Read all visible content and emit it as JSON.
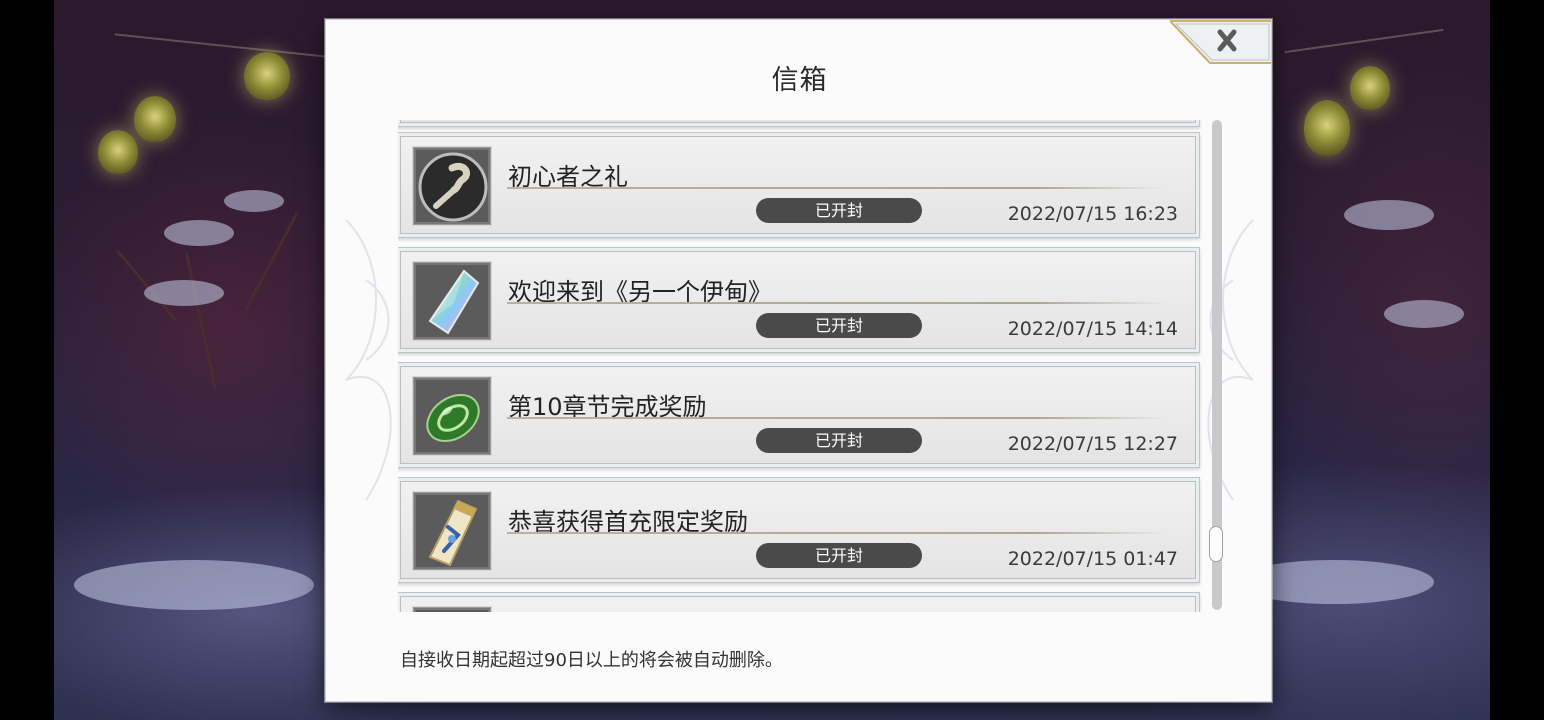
{
  "dialog": {
    "title": "信箱",
    "close_icon": "close-icon",
    "footer_note": "自接收日期起超过90日以上的将会被自动删除。"
  },
  "mails": [
    {
      "title": "初心者之礼",
      "status": "已开封",
      "time": "2022/07/15 16:23",
      "icon": "novice-staff-icon"
    },
    {
      "title": "欢迎来到《另一个伊甸》",
      "status": "已开封",
      "time": "2022/07/15 14:14",
      "icon": "rainbow-crystal-icon"
    },
    {
      "title": "第10章节完成奖励",
      "status": "已开封",
      "time": "2022/07/15 12:27",
      "icon": "green-gem-icon"
    },
    {
      "title": "恭喜获得首充限定奖励",
      "status": "已开封",
      "time": "2022/07/15 01:47",
      "icon": "ticket-icon"
    }
  ],
  "scrollbar": {
    "position_fraction": 0.88
  },
  "colors": {
    "status_badge": "#4a4a4a",
    "panel_bg": "#fbfbfc",
    "close_tab_border": "#c9b26a"
  }
}
